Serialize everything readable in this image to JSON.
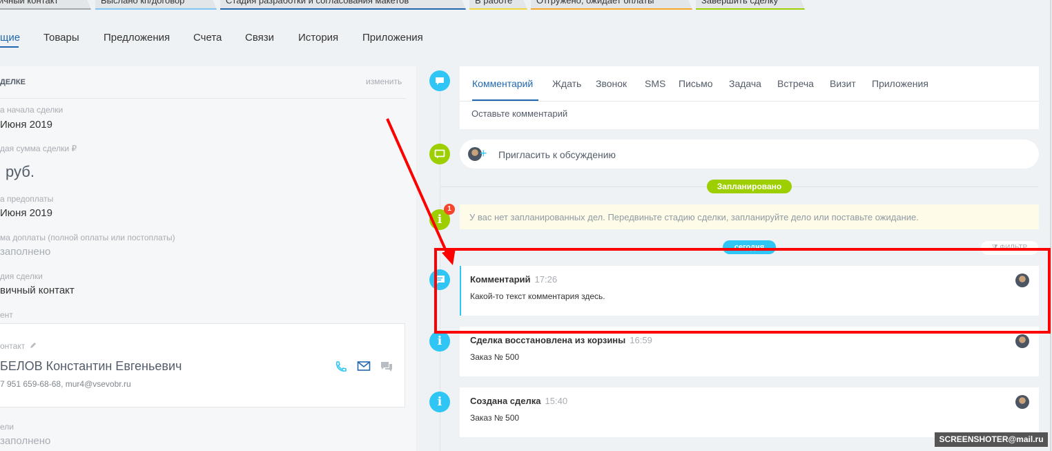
{
  "stages": [
    {
      "label": "ичный контакт",
      "color": "#a0a8b0"
    },
    {
      "label": "Выслано кп/договор",
      "color": "#7fc4f2"
    },
    {
      "label": "Стадия разработки и согласования макетов",
      "color": "#2067b0"
    },
    {
      "label": "В работе",
      "color": "#f0d63c"
    },
    {
      "label": "Отгружено, ожидает оплаты",
      "color": "#f5a623"
    },
    {
      "label": "Завершить сделку",
      "color": "#9dcf00"
    }
  ],
  "tabs": [
    "щие",
    "Товары",
    "Предложения",
    "Счета",
    "Связи",
    "История",
    "Приложения"
  ],
  "about": {
    "title": "ДЕЛКЕ",
    "change": "изменить",
    "fields": [
      {
        "label": "а начала сделки",
        "value": "Июня 2019"
      },
      {
        "label": "дая сумма сделки ₽",
        "value": "руб."
      },
      {
        "label": "а предоплаты",
        "value": "Июня 2019"
      },
      {
        "label": "ма доплаты (полной оплаты или постоплаты)",
        "value": "заполнено"
      },
      {
        "label": "дия сделки",
        "value": "вичный контакт"
      }
    ],
    "client_label": "ент",
    "contact_label": "онтакт",
    "contact_name": "БЕЛОВ Константин Евгеньевич",
    "contact_details": "7 951 659-68-68, mur4@vsevobr.ru",
    "bottom_label": "ели",
    "bottom_value": "заполнено"
  },
  "editor": {
    "tabs": [
      "Комментарий",
      "Ждать",
      "Звонок",
      "SMS",
      "Письмо",
      "Задача",
      "Встреча",
      "Визит",
      "Приложения"
    ],
    "placeholder": "Оставьте комментарий"
  },
  "invite": "Пригласить к обсуждению",
  "planned": {
    "badge": "Запланировано",
    "counter": "1",
    "text": "У вас нет запланированных дел. Передвиньте стадию сделки, запланируйте дело или поставьте ожидание."
  },
  "today_badge": "сегодня",
  "filter": "ФИЛЬТР",
  "events": [
    {
      "title": "Комментарий",
      "time": "17:26",
      "text": "Какой-то текст комментария здесь."
    },
    {
      "title": "Сделка восстановлена из корзины",
      "time": "16:59",
      "text": "Заказ № 500"
    },
    {
      "title": "Создана сделка",
      "time": "15:40",
      "text": "Заказ № 500"
    }
  ],
  "watermark": "SCREENSHOTER@mail.ru",
  "colors": {
    "accent": "#2067b0",
    "info": "#2fc6f6",
    "green": "#9dcf00",
    "annotation": "#ff0000"
  }
}
